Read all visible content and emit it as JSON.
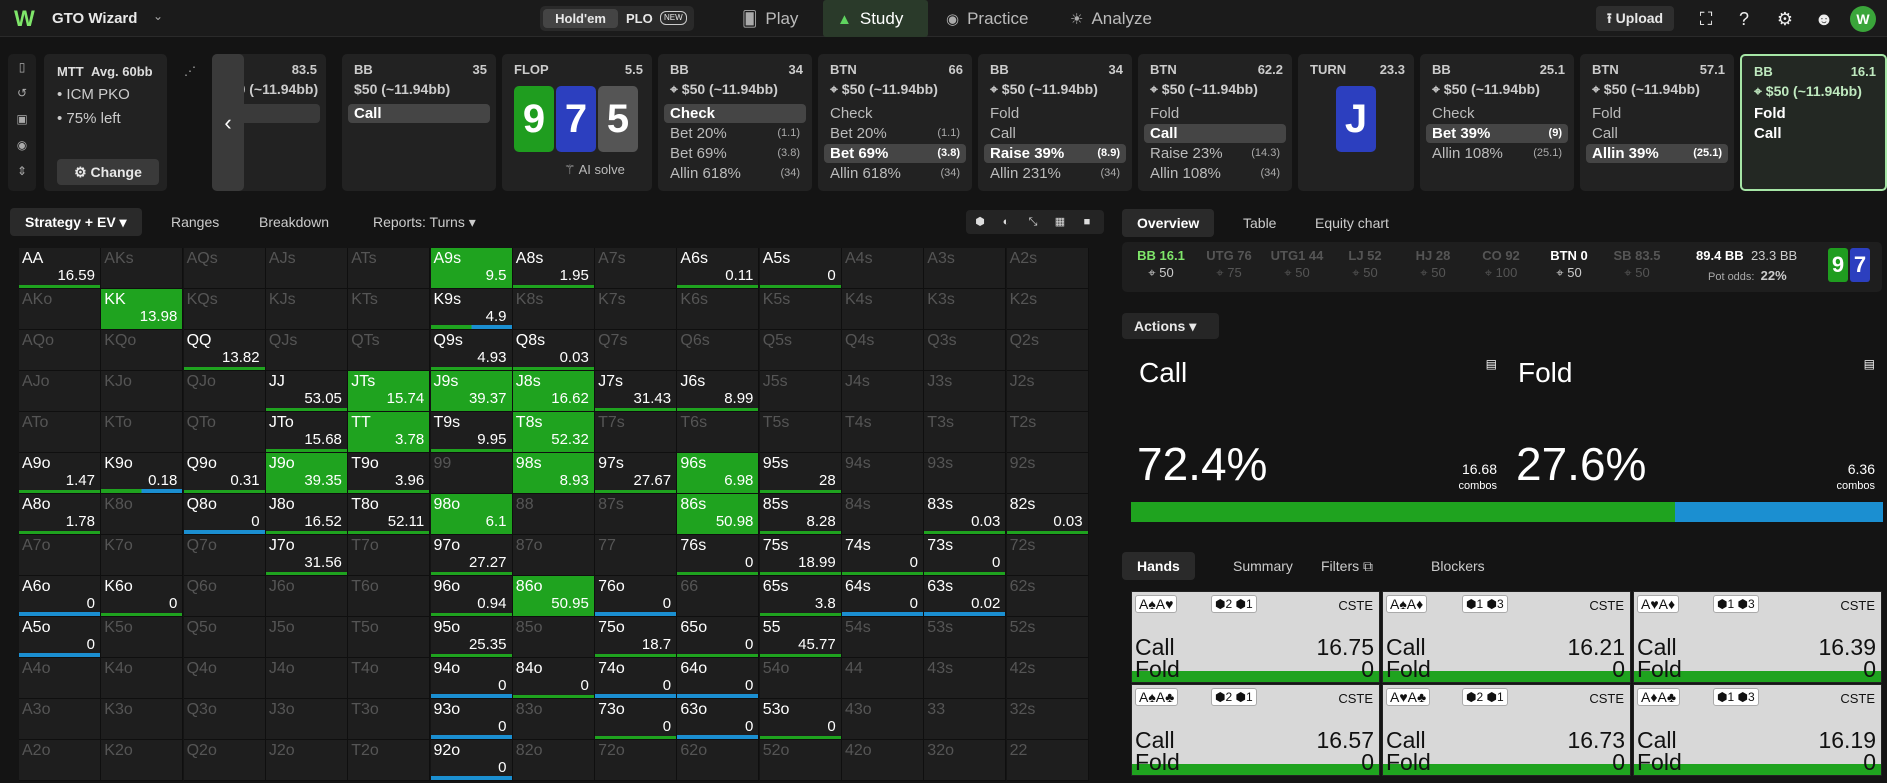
{
  "app": {
    "name": "GTO Wizard",
    "logo": "W"
  },
  "gametype": {
    "holdem": "Hold'em",
    "plo": "PLO",
    "plo_badge": "NEW"
  },
  "nav": [
    {
      "label": "Play",
      "icon": "cards-icon"
    },
    {
      "label": "Study",
      "icon": "graduation-cap-icon"
    },
    {
      "label": "Practice",
      "icon": "gamepad-icon"
    },
    {
      "label": "Analyze",
      "icon": "bulb-icon"
    }
  ],
  "top": {
    "upload": "Upload",
    "avatar": "W"
  },
  "settings": {
    "title": "MTT",
    "avg": "Avg. 60bb",
    "line1": "ICM PKO",
    "line2": "75% left",
    "change": "Change"
  },
  "first": {
    "stack": "83.5",
    "bet": "$50 (~11.94bb)"
  },
  "seats": [
    {
      "pos": "BB",
      "stack": "35",
      "bet": "$50 (~11.94bb)",
      "actions": [
        {
          "label": "Call",
          "freq": "",
          "sel": true
        }
      ]
    },
    {
      "pos": "BB",
      "stack": "34",
      "bet": "$50 (~11.94bb)",
      "actions": [
        {
          "label": "Check",
          "freq": "",
          "sel": true
        },
        {
          "label": "Bet 20%",
          "freq": "(1.1)"
        },
        {
          "label": "Bet 69%",
          "freq": "(3.8)"
        },
        {
          "label": "Allin 618%",
          "freq": "(34)"
        }
      ]
    },
    {
      "pos": "BTN",
      "stack": "66",
      "bet": "$50 (~11.94bb)",
      "actions": [
        {
          "label": "Check",
          "freq": ""
        },
        {
          "label": "Bet 20%",
          "freq": "(1.1)"
        },
        {
          "label": "Bet 69%",
          "freq": "(3.8)",
          "sel": true
        },
        {
          "label": "Allin 618%",
          "freq": "(34)"
        }
      ]
    },
    {
      "pos": "BB",
      "stack": "34",
      "bet": "$50 (~11.94bb)",
      "actions": [
        {
          "label": "Fold",
          "freq": ""
        },
        {
          "label": "Call",
          "freq": ""
        },
        {
          "label": "Raise 39%",
          "freq": "(8.9)",
          "sel": true
        },
        {
          "label": "Allin 231%",
          "freq": "(34)"
        }
      ]
    },
    {
      "pos": "BTN",
      "stack": "62.2",
      "bet": "$50 (~11.94bb)",
      "actions": [
        {
          "label": "Fold",
          "freq": ""
        },
        {
          "label": "Call",
          "freq": "",
          "sel": true
        },
        {
          "label": "Raise 23%",
          "freq": "(14.3)"
        },
        {
          "label": "Allin 108%",
          "freq": "(34)"
        }
      ]
    },
    {
      "pos": "BB",
      "stack": "25.1",
      "bet": "$50 (~11.94bb)",
      "actions": [
        {
          "label": "Check",
          "freq": ""
        },
        {
          "label": "Bet 39%",
          "freq": "(9)",
          "sel": true
        },
        {
          "label": "Allin 108%",
          "freq": "(25.1)"
        }
      ]
    },
    {
      "pos": "BTN",
      "stack": "57.1",
      "bet": "$50 (~11.94bb)",
      "actions": [
        {
          "label": "Fold",
          "freq": ""
        },
        {
          "label": "Call",
          "freq": ""
        },
        {
          "label": "Allin 39%",
          "freq": "(25.1)",
          "sel": true
        }
      ]
    },
    {
      "pos": "BB",
      "stack": "16.1",
      "bet": "$50 (~11.94bb)",
      "actions": [
        {
          "label": "Fold",
          "freq": ""
        },
        {
          "label": "Call",
          "freq": ""
        }
      ]
    }
  ],
  "flop": {
    "label": "FLOP",
    "pot": "5.5",
    "cards": [
      "9",
      "7",
      "5"
    ],
    "ai": "AI solve"
  },
  "turn": {
    "label": "TURN",
    "pot": "23.3",
    "card": "J"
  },
  "left_tabs": [
    "Strategy + EV",
    "Ranges",
    "Breakdown",
    "Reports: Turns"
  ],
  "grid": [
    [
      "AA",
      "16.59",
      0.99,
      0
    ],
    [
      "AKs",
      "",
      0,
      0
    ],
    [
      "AQs",
      "",
      0,
      0
    ],
    [
      "AJs",
      "",
      0,
      0
    ],
    [
      "ATs",
      "",
      0,
      0
    ],
    [
      "A9s",
      "9.5",
      1,
      0
    ],
    [
      "A8s",
      "1.95",
      1,
      0
    ],
    [
      "A7s",
      "",
      0,
      0
    ],
    [
      "A6s",
      "0.11",
      1,
      0
    ],
    [
      "A5s",
      "0",
      0,
      0
    ],
    [
      "A4s",
      "",
      0,
      0
    ],
    [
      "A3s",
      "",
      0,
      0
    ],
    [
      "A2s",
      "",
      0,
      0
    ],
    [
      "AKo",
      "",
      0,
      0
    ],
    [
      "KK",
      "13.98",
      1,
      0
    ],
    [
      "KQs",
      "",
      0,
      0
    ],
    [
      "KJs",
      "",
      0,
      0
    ],
    [
      "KTs",
      "",
      0,
      0
    ],
    [
      "K9s",
      "4.9",
      0.9,
      1
    ],
    [
      "K8s",
      "",
      0,
      0
    ],
    [
      "K7s",
      "",
      0,
      0
    ],
    [
      "K6s",
      "",
      0,
      0
    ],
    [
      "K5s",
      "",
      0,
      0
    ],
    [
      "K4s",
      "",
      0,
      0
    ],
    [
      "K3s",
      "",
      0,
      0
    ],
    [
      "K2s",
      "",
      0,
      0
    ],
    [
      "AQo",
      "",
      0,
      0
    ],
    [
      "KQo",
      "",
      0,
      0
    ],
    [
      "QQ",
      "13.82",
      1,
      0
    ],
    [
      "QJs",
      "",
      0,
      0
    ],
    [
      "QTs",
      "",
      0,
      0
    ],
    [
      "Q9s",
      "4.93",
      1,
      0
    ],
    [
      "Q8s",
      "0.03",
      1,
      0
    ],
    [
      "Q7s",
      "",
      0,
      0
    ],
    [
      "Q6s",
      "",
      0,
      0
    ],
    [
      "Q5s",
      "",
      0,
      0
    ],
    [
      "Q4s",
      "",
      0,
      0
    ],
    [
      "Q3s",
      "",
      0,
      0
    ],
    [
      "Q2s",
      "",
      0,
      0
    ],
    [
      "AJo",
      "",
      0,
      0
    ],
    [
      "KJo",
      "",
      0,
      0
    ],
    [
      "QJo",
      "",
      0,
      0
    ],
    [
      "JJ",
      "53.05",
      1,
      0
    ],
    [
      "JTs",
      "15.74",
      1,
      0
    ],
    [
      "J9s",
      "39.37",
      1,
      0
    ],
    [
      "J8s",
      "16.62",
      1,
      0
    ],
    [
      "J7s",
      "31.43",
      1,
      0
    ],
    [
      "J6s",
      "8.99",
      1,
      0
    ],
    [
      "J5s",
      "",
      0,
      0
    ],
    [
      "J4s",
      "",
      0,
      0
    ],
    [
      "J3s",
      "",
      0,
      0
    ],
    [
      "J2s",
      "",
      0,
      0
    ],
    [
      "ATo",
      "",
      0,
      0
    ],
    [
      "KTo",
      "",
      0,
      0
    ],
    [
      "QTo",
      "",
      0,
      0
    ],
    [
      "JTo",
      "15.68",
      1,
      0
    ],
    [
      "TT",
      "3.78",
      1,
      0
    ],
    [
      "T9s",
      "9.95",
      1,
      0
    ],
    [
      "T8s",
      "52.32",
      1,
      0
    ],
    [
      "T7s",
      "",
      0,
      0
    ],
    [
      "T6s",
      "",
      0,
      0
    ],
    [
      "T5s",
      "",
      0,
      0
    ],
    [
      "T4s",
      "",
      0,
      0
    ],
    [
      "T3s",
      "",
      0,
      0
    ],
    [
      "T2s",
      "",
      0,
      0
    ],
    [
      "A9o",
      "1.47",
      1,
      0
    ],
    [
      "K9o",
      "0.18",
      0.5,
      1
    ],
    [
      "Q9o",
      "0.31",
      1,
      0
    ],
    [
      "J9o",
      "39.35",
      1,
      0
    ],
    [
      "T9o",
      "3.96",
      1,
      0
    ],
    [
      "99",
      "",
      0,
      0
    ],
    [
      "98s",
      "8.93",
      1,
      0
    ],
    [
      "97s",
      "27.67",
      1,
      0
    ],
    [
      "96s",
      "6.98",
      1,
      0
    ],
    [
      "95s",
      "28",
      1,
      0
    ],
    [
      "94s",
      "",
      0,
      0
    ],
    [
      "93s",
      "",
      0,
      0
    ],
    [
      "92s",
      "",
      0,
      0
    ],
    [
      "A8o",
      "1.78",
      1,
      0
    ],
    [
      "K8o",
      "",
      0,
      0
    ],
    [
      "Q8o",
      "0",
      0,
      1
    ],
    [
      "J8o",
      "16.52",
      1,
      0
    ],
    [
      "T8o",
      "52.11",
      1,
      0
    ],
    [
      "98o",
      "6.1",
      1,
      0
    ],
    [
      "88",
      "",
      0,
      0
    ],
    [
      "87s",
      "",
      0,
      0
    ],
    [
      "86s",
      "50.98",
      1,
      0
    ],
    [
      "85s",
      "8.28",
      1,
      0
    ],
    [
      "84s",
      "",
      0,
      0
    ],
    [
      "83s",
      "0.03",
      1,
      0
    ],
    [
      "82s",
      "0.03",
      1,
      0
    ],
    [
      "A7o",
      "",
      0,
      0
    ],
    [
      "K7o",
      "",
      0,
      0
    ],
    [
      "Q7o",
      "",
      0,
      0
    ],
    [
      "J7o",
      "31.56",
      1,
      0
    ],
    [
      "T7o",
      "",
      0,
      0
    ],
    [
      "97o",
      "27.27",
      1,
      0
    ],
    [
      "87o",
      "",
      0,
      0
    ],
    [
      "77",
      "",
      0,
      0
    ],
    [
      "76s",
      "0",
      1,
      0
    ],
    [
      "75s",
      "18.99",
      1,
      0
    ],
    [
      "74s",
      "0",
      1,
      0
    ],
    [
      "73s",
      "0",
      1,
      0
    ],
    [
      "72s",
      "",
      0,
      0
    ],
    [
      "A6o",
      "0",
      0,
      1
    ],
    [
      "K6o",
      "0",
      1,
      0
    ],
    [
      "Q6o",
      "",
      0,
      0
    ],
    [
      "J6o",
      "",
      0,
      0
    ],
    [
      "T6o",
      "",
      0,
      0
    ],
    [
      "96o",
      "0.94",
      1,
      0
    ],
    [
      "86o",
      "50.95",
      1,
      0
    ],
    [
      "76o",
      "0",
      0,
      1
    ],
    [
      "66",
      "",
      0,
      0
    ],
    [
      "65s",
      "3.8",
      1,
      0
    ],
    [
      "64s",
      "0",
      0,
      1
    ],
    [
      "63s",
      "0.02",
      0,
      1
    ],
    [
      "62s",
      "",
      0,
      0
    ],
    [
      "A5o",
      "0",
      0,
      1
    ],
    [
      "K5o",
      "",
      0,
      0
    ],
    [
      "Q5o",
      "",
      0,
      0
    ],
    [
      "J5o",
      "",
      0,
      0
    ],
    [
      "T5o",
      "",
      0,
      0
    ],
    [
      "95o",
      "25.35",
      1,
      0
    ],
    [
      "85o",
      "",
      0,
      0
    ],
    [
      "75o",
      "18.7",
      1,
      0
    ],
    [
      "65o",
      "0",
      1,
      0
    ],
    [
      "55",
      "45.77",
      1,
      0
    ],
    [
      "54s",
      "",
      0,
      0
    ],
    [
      "53s",
      "",
      0,
      0
    ],
    [
      "52s",
      "",
      0,
      0
    ],
    [
      "A4o",
      "",
      0,
      0
    ],
    [
      "K4o",
      "",
      0,
      0
    ],
    [
      "Q4o",
      "",
      0,
      0
    ],
    [
      "J4o",
      "",
      0,
      0
    ],
    [
      "T4o",
      "",
      0,
      0
    ],
    [
      "94o",
      "0",
      0,
      1
    ],
    [
      "84o",
      "0",
      1,
      0
    ],
    [
      "74o",
      "0",
      0,
      1
    ],
    [
      "64o",
      "0",
      0,
      1
    ],
    [
      "54o",
      "",
      0,
      0
    ],
    [
      "44",
      "",
      0,
      0
    ],
    [
      "43s",
      "",
      0,
      0
    ],
    [
      "42s",
      "",
      0,
      0
    ],
    [
      "A3o",
      "",
      0,
      0
    ],
    [
      "K3o",
      "",
      0,
      0
    ],
    [
      "Q3o",
      "",
      0,
      0
    ],
    [
      "J3o",
      "",
      0,
      0
    ],
    [
      "T3o",
      "",
      0,
      0
    ],
    [
      "93o",
      "0",
      0,
      1
    ],
    [
      "83o",
      "",
      0,
      0
    ],
    [
      "73o",
      "0",
      1,
      0
    ],
    [
      "63o",
      "0",
      0,
      1
    ],
    [
      "53o",
      "0",
      1,
      0
    ],
    [
      "43o",
      "",
      0,
      0
    ],
    [
      "33",
      "",
      0,
      0
    ],
    [
      "32s",
      "",
      0,
      0
    ],
    [
      "A2o",
      "",
      0,
      0
    ],
    [
      "K2o",
      "",
      0,
      0
    ],
    [
      "Q2o",
      "",
      0,
      0
    ],
    [
      "J2o",
      "",
      0,
      0
    ],
    [
      "T2o",
      "",
      0,
      0
    ],
    [
      "92o",
      "0",
      0,
      1
    ],
    [
      "82o",
      "",
      0,
      0
    ],
    [
      "72o",
      "",
      0,
      0
    ],
    [
      "62o",
      "",
      0,
      0
    ],
    [
      "52o",
      "",
      0,
      0
    ],
    [
      "42o",
      "",
      0,
      0
    ],
    [
      "32o",
      "",
      0,
      0
    ],
    [
      "22",
      "",
      0,
      0
    ]
  ],
  "right_tabs": [
    "Overview",
    "Table",
    "Equity chart"
  ],
  "seatrow": [
    {
      "n": "BB 16.1",
      "s": "50",
      "st": "hero"
    },
    {
      "n": "UTG 76",
      "s": "75",
      "st": ""
    },
    {
      "n": "UTG1 44",
      "s": "50",
      "st": ""
    },
    {
      "n": "LJ 52",
      "s": "50",
      "st": ""
    },
    {
      "n": "HJ 28",
      "s": "50",
      "st": ""
    },
    {
      "n": "CO 92",
      "s": "100",
      "st": ""
    },
    {
      "n": "BTN 0",
      "s": "50",
      "st": "on"
    },
    {
      "n": "SB 83.5",
      "s": "50",
      "st": ""
    }
  ],
  "pot": {
    "bb": "89.4 BB",
    "bb2": "23.3 BB",
    "odds_label": "Pot odds:",
    "odds": "22%"
  },
  "actions_title": "Actions",
  "action_boxes": [
    {
      "label": "Call",
      "pct": "72.4%",
      "combos": "16.68",
      "combos_label": "combos",
      "color": "#1fa31f"
    },
    {
      "label": "Fold",
      "pct": "27.6%",
      "combos": "6.36",
      "combos_label": "combos",
      "color": "#1b8fd1"
    }
  ],
  "call_freq": 0.724,
  "hands_tabs": [
    "Hands",
    "Summary",
    "Filters",
    "Blockers"
  ],
  "hand_cards": [
    {
      "combo": "A♠A♥",
      "tags": "⬢2 ⬢1",
      "cste": "CSTE",
      "call": "16.75",
      "fold": "0"
    },
    {
      "combo": "A♠A♦",
      "tags": "⬢1 ⬢3",
      "cste": "CSTE",
      "call": "16.21",
      "fold": "0"
    },
    {
      "combo": "A♥A♦",
      "tags": "⬢1 ⬢3",
      "cste": "CSTE",
      "call": "16.39",
      "fold": "0"
    },
    {
      "combo": "A♠A♣",
      "tags": "⬢2 ⬢1",
      "cste": "CSTE",
      "call": "16.57",
      "fold": "0"
    },
    {
      "combo": "A♥A♣",
      "tags": "⬢2 ⬢1",
      "cste": "CSTE",
      "call": "16.73",
      "fold": "0"
    },
    {
      "combo": "A♦A♣",
      "tags": "⬢1 ⬢3",
      "cste": "CSTE",
      "call": "16.19",
      "fold": "0"
    }
  ],
  "colors": {
    "green": "#1fa31f",
    "blue": "#1b8fd1"
  }
}
